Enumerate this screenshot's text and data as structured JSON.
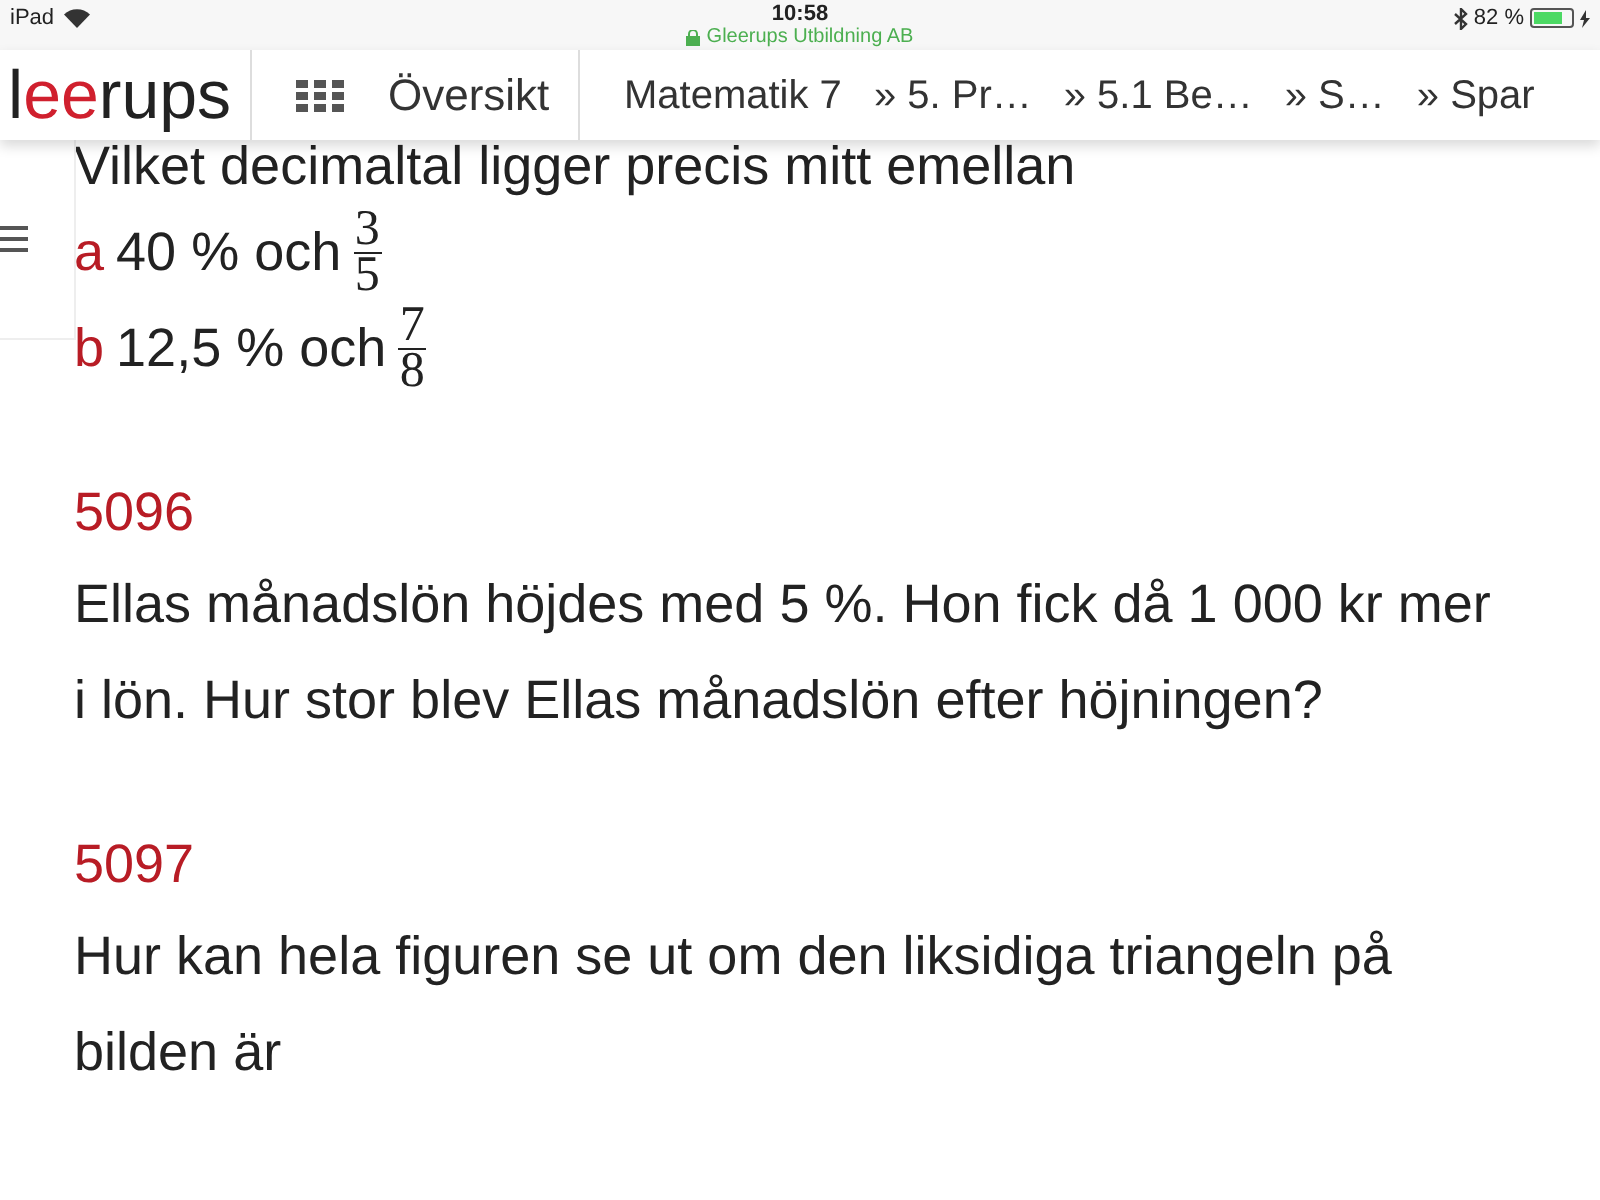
{
  "status_bar": {
    "device": "iPad",
    "time": "10:58",
    "site": "Gleerups Utbildning AB",
    "battery": "82 %"
  },
  "header": {
    "logo": {
      "lead": "l",
      "accent": "ee",
      "rest": "rups"
    },
    "overview": "Översikt",
    "breadcrumbs": [
      {
        "label": "Matematik 7"
      },
      {
        "label": "» 5. Pr…"
      },
      {
        "label": "» 5.1 Be…"
      },
      {
        "label": "» S…"
      },
      {
        "label": "» Spar"
      }
    ]
  },
  "content": {
    "intro": "Vilket decimaltal ligger precis mitt emellan",
    "parts": [
      {
        "letter": "a",
        "text": "40 % och",
        "numerator": "3",
        "denominator": "5"
      },
      {
        "letter": "b",
        "text": "12,5 % och",
        "numerator": "7",
        "denominator": "8"
      }
    ],
    "tasks": [
      {
        "number": "5096",
        "text": "Ellas månadslön höjdes med 5 %. Hon fick då 1 000 kr mer i lön. Hur stor blev Ellas månadslön efter höjningen?"
      },
      {
        "number": "5097",
        "text": "Hur kan hela figuren se ut om den liksidiga triangeln på bilden är"
      }
    ]
  }
}
